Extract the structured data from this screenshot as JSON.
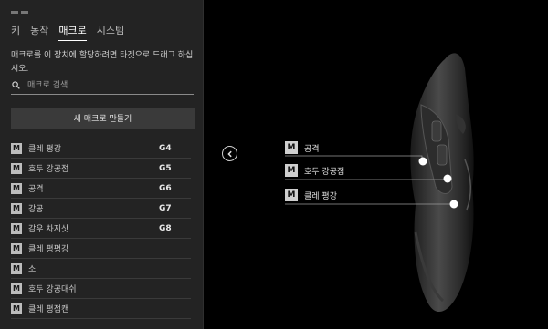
{
  "tabs": [
    "키",
    "동작",
    "매크로",
    "시스템"
  ],
  "active_tab": 2,
  "description": "매크로를 이 장치에 할당하려면 타겟으로 드래그 하십시오.",
  "search": {
    "placeholder": "매크로 검색",
    "icon": "search-icon"
  },
  "new_macro_button": "새 매크로 만들기",
  "macros": [
    {
      "icon": "M",
      "name": "클레 평강",
      "key": "G4"
    },
    {
      "icon": "M",
      "name": "호두 강공점",
      "key": "G5"
    },
    {
      "icon": "M",
      "name": "공격",
      "key": "G6"
    },
    {
      "icon": "M",
      "name": "강공",
      "key": "G7"
    },
    {
      "icon": "M",
      "name": "감우 차지샷",
      "key": "G8"
    },
    {
      "icon": "M",
      "name": "클레 평평강",
      "key": ""
    },
    {
      "icon": "M",
      "name": "소",
      "key": ""
    },
    {
      "icon": "M",
      "name": "호두 강공대쉬",
      "key": ""
    },
    {
      "icon": "M",
      "name": "클레 평점캔",
      "key": ""
    }
  ],
  "assignments": [
    {
      "icon": "M",
      "label": "공격"
    },
    {
      "icon": "M",
      "label": "호두 강공점"
    },
    {
      "icon": "M",
      "label": "클레 평강"
    }
  ],
  "colors": {
    "panel_bg": "#232323",
    "canvas_bg": "#000000",
    "badge": "#cfcfcf"
  }
}
